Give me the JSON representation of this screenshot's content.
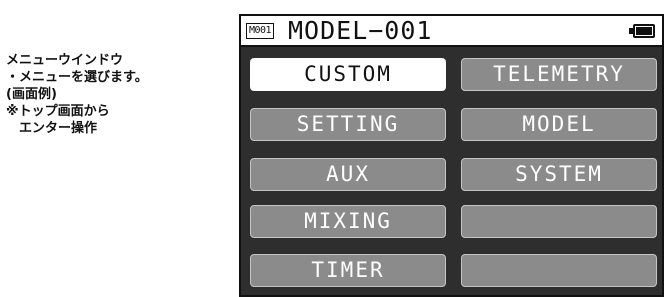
{
  "caption": {
    "line1": "メニューウインドウ",
    "line2": "・メニューを選びます。",
    "line3": "(画面例)",
    "line4": "※トップ画面から",
    "line5": "　エンター操作"
  },
  "header": {
    "model_badge": "M001",
    "model_name": "MODEL−001",
    "battery_icon": "battery-icon"
  },
  "menu": {
    "selected": "CUSTOM",
    "items": [
      {
        "label": "CUSTOM"
      },
      {
        "label": "TELEMETRY"
      },
      {
        "label": "SETTING"
      },
      {
        "label": "MODEL"
      },
      {
        "label": "AUX"
      },
      {
        "label": "SYSTEM"
      },
      {
        "label": "MIXING"
      },
      {
        "label": ""
      },
      {
        "label": "TIMER"
      },
      {
        "label": ""
      }
    ]
  }
}
